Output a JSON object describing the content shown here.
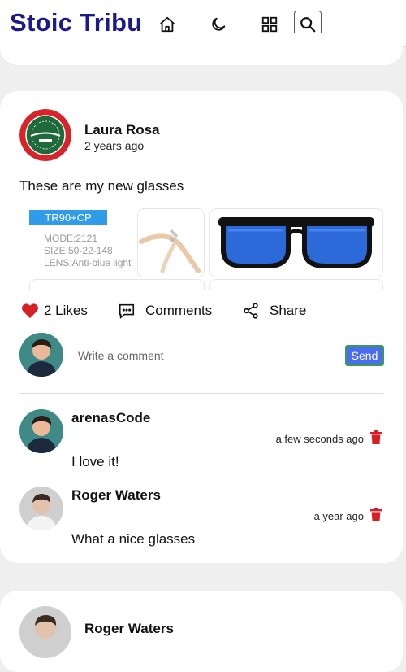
{
  "header": {
    "brand": "Stoic Tribu",
    "nav": [
      "home-icon",
      "moon-icon",
      "grid-icon",
      "search-icon"
    ]
  },
  "post": {
    "author": "Laura Rosa",
    "time": "2 years ago",
    "text": "These are my new glasses",
    "product": {
      "tag": "TR90+CP",
      "specs": [
        "MODE:2121",
        "SIZE:50-22-148",
        "LENS:Anti-blue light"
      ]
    },
    "actions": {
      "likes": "2 Likes",
      "comments": "Comments",
      "share": "Share"
    },
    "comment_box": {
      "placeholder": "Write a comment",
      "send": "Send"
    },
    "comments": [
      {
        "author": "arenasCode",
        "time": "a few seconds ago",
        "text": "I love it!"
      },
      {
        "author": "Roger Waters",
        "time": "a year ago",
        "text": "What a nice glasses"
      }
    ]
  },
  "next_post": {
    "author": "Roger Waters"
  },
  "colors": {
    "brand": "#1b1a8c",
    "like_heart": "#d61f26",
    "send_button": "#4a6cf0",
    "trash": "#d61f26",
    "tag": "#2f9be9"
  }
}
